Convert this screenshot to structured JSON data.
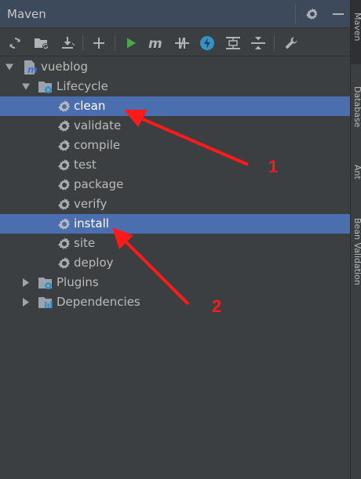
{
  "panel": {
    "title": "Maven"
  },
  "tree": {
    "project": "vueblog",
    "lifecycle_label": "Lifecycle",
    "phases": [
      "clean",
      "validate",
      "compile",
      "test",
      "package",
      "verify",
      "install",
      "site",
      "deploy"
    ],
    "plugins_label": "Plugins",
    "dependencies_label": "Dependencies"
  },
  "side_tabs": {
    "maven": "Maven",
    "database": "Database",
    "ant": "Ant",
    "bean_validation": "Bean Validation"
  },
  "annotations": {
    "marker_1": "1",
    "marker_2": "2"
  },
  "colors": {
    "selection": "#4b6eaf",
    "arrow": "#ff1a1a",
    "panel_bg": "#3c3f41",
    "title_bg": "#3d4a5c"
  }
}
